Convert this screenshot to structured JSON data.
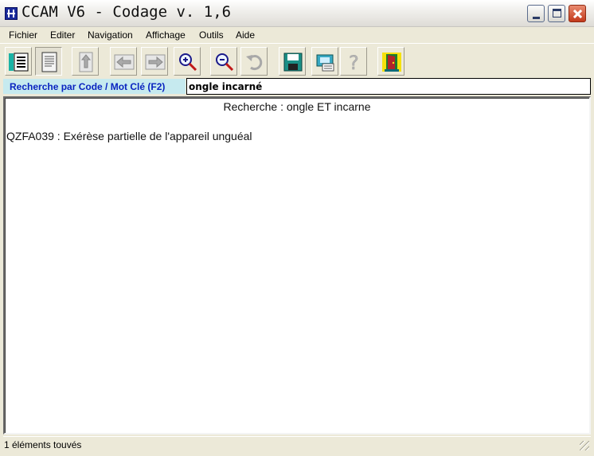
{
  "window": {
    "title": "CCAM V6 - Codage  v. 1,6"
  },
  "menu": {
    "items": [
      "Fichier",
      "Editer",
      "Navigation",
      "Affichage",
      "Outils",
      "Aide"
    ]
  },
  "toolbar": {
    "buttons": [
      "list-view-icon",
      "document-view-icon",
      "page-up-icon",
      "arrow-left-icon",
      "arrow-right-icon",
      "zoom-in-icon",
      "zoom-out-icon",
      "undo-icon",
      "save-icon",
      "print-icon",
      "help-icon",
      "exit-door-icon"
    ]
  },
  "search": {
    "label": "Recherche par Code / Mot Clé (F2)",
    "value": "ongle incarné"
  },
  "results": {
    "header": "Recherche : ongle ET incarne",
    "items": [
      "QZFA039 : Exérèse partielle de l'appareil unguéal"
    ]
  },
  "status": {
    "text": "1 éléments touvés"
  },
  "colors": {
    "search_label_bg": "#c6eaef",
    "search_label_text": "#0a24c0",
    "window_bg": "#ece9d8"
  }
}
